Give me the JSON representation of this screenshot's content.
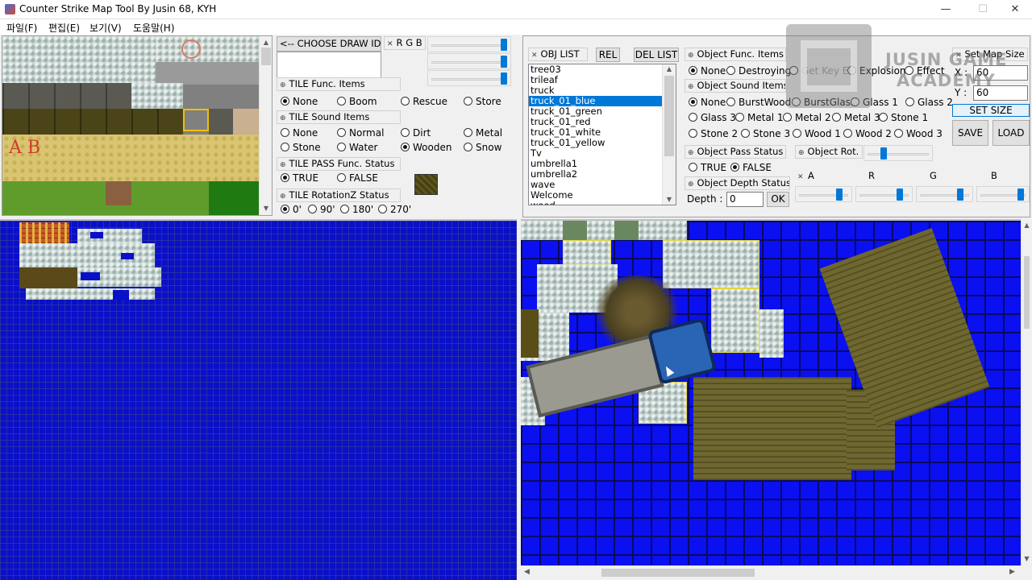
{
  "window": {
    "title": "Counter Strike Map Tool By Jusin 68, KYH",
    "controls": [
      "—",
      "☐",
      "✕"
    ]
  },
  "menu": [
    "파일(F)",
    "편집(E)",
    "보기(V)",
    "도움말(H)"
  ],
  "tile_panel": {
    "choose_draw_id": "<-- CHOOSE DRAW ID",
    "rgb_label": "R G B",
    "func_title": "TILE Func. Items",
    "func_options": [
      "None",
      "Boom",
      "Rescue",
      "Store"
    ],
    "func_selected": "None",
    "sound_title": "TILE Sound Items",
    "sound_options": [
      "None",
      "Normal",
      "Dirt",
      "Metal",
      "Stone",
      "Water",
      "Wooden",
      "Snow"
    ],
    "sound_selected": "Wooden",
    "pass_title": "TILE PASS Func. Status",
    "pass_options": [
      "TRUE",
      "FALSE"
    ],
    "pass_selected": "TRUE",
    "rot_title": "TILE RotationZ Status",
    "rot_options": [
      "0'",
      "90'",
      "180'",
      "270'"
    ],
    "rot_selected": "0'"
  },
  "obj_panel": {
    "list_title": "OBJ LIST",
    "rel_button": "REL",
    "del_button": "DEL LIST",
    "items": [
      "tree03",
      "trileaf",
      "truck",
      "truck_01_blue",
      "truck_01_green",
      "truck_01_red",
      "truck_01_white",
      "truck_01_yellow",
      "Tv",
      "umbrella1",
      "umbrella2",
      "wave",
      "Welcome",
      "wood"
    ],
    "selected": "truck_01_blue",
    "func_title": "Object Func. Items",
    "func_options": [
      "None",
      "Destroying",
      "Get Key E",
      "Explosion",
      "Effect"
    ],
    "func_selected": "None",
    "sound_title": "Object Sound Items",
    "sound_options": [
      "None",
      "BurstWood",
      "BurstGlass",
      "Glass 1",
      "Glass 2",
      "Glass 3",
      "Metal 1",
      "Metal 2",
      "Metal 3",
      "Stone 1",
      "Stone 2",
      "Stone 3",
      "Wood 1",
      "Wood 2",
      "Wood 3"
    ],
    "sound_selected": "None",
    "pass_title": "Object Pass Status",
    "pass_options": [
      "TRUE",
      "FALSE"
    ],
    "pass_selected": "FALSE",
    "rot_title": "Object Rot.",
    "depth_title": "Object Depth Status",
    "depth_label": "Depth :",
    "depth_value": "0",
    "ok_button": "OK",
    "argb_labels": [
      "A",
      "R",
      "G",
      "B"
    ]
  },
  "map_size": {
    "title": "Set Map Size",
    "x_label": "X :",
    "x_value": "60",
    "y_label": "Y :",
    "y_value": "60",
    "set_button": "SET SIZE",
    "save_button": "SAVE",
    "load_button": "LOAD"
  },
  "watermark": {
    "line1": "JUSIN GAME",
    "line2": "ACADEMY"
  }
}
